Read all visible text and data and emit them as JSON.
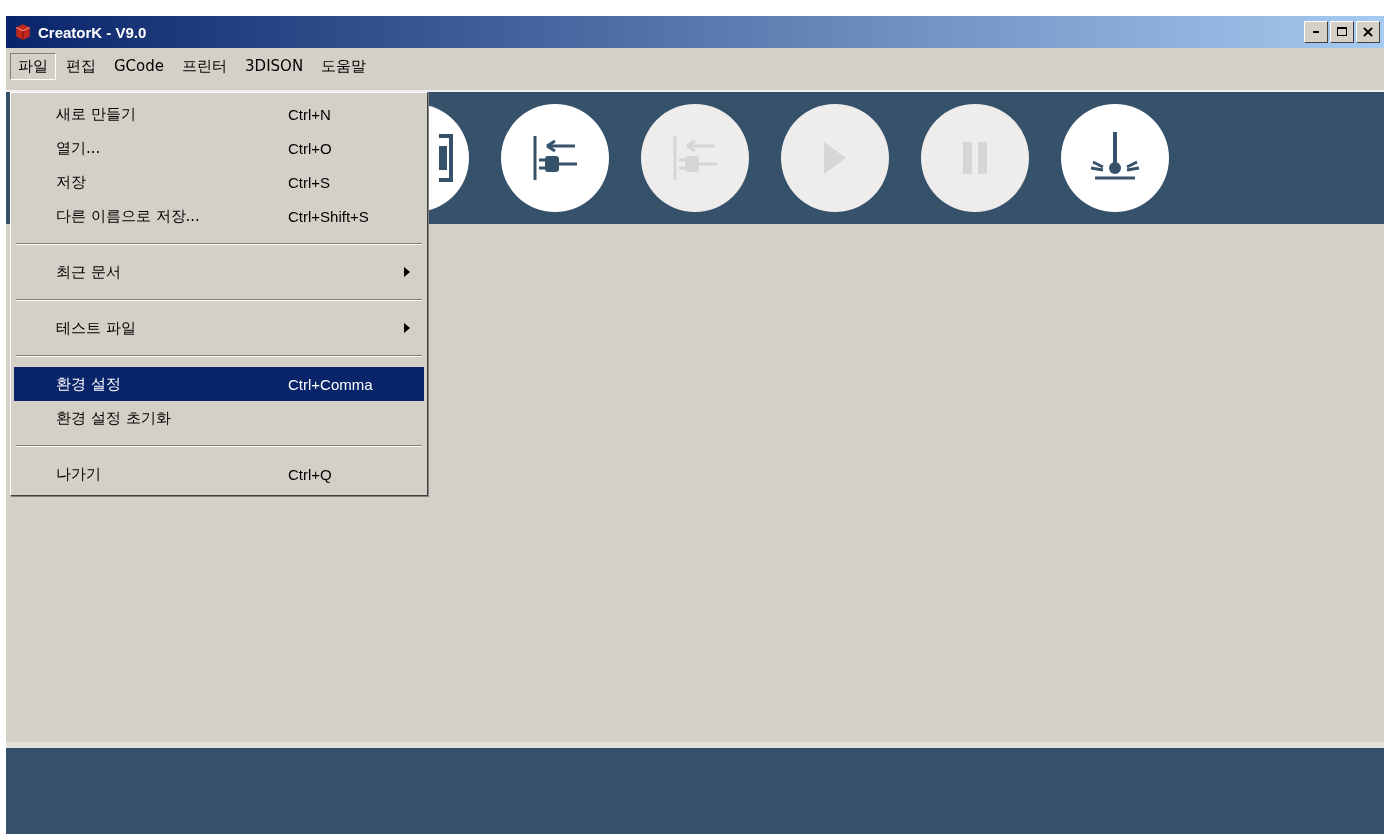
{
  "window": {
    "title": "CreatorK - V9.0"
  },
  "menubar": [
    {
      "label": "파일",
      "selected": true
    },
    {
      "label": "편집",
      "selected": false
    },
    {
      "label": "GCode",
      "selected": false
    },
    {
      "label": "프린터",
      "selected": false
    },
    {
      "label": "3DISON",
      "selected": false
    },
    {
      "label": "도움말",
      "selected": false
    }
  ],
  "file_menu": [
    {
      "kind": "item",
      "label": "새로 만들기",
      "shortcut": "Ctrl+N",
      "selected": false
    },
    {
      "kind": "item",
      "label": "열기...",
      "shortcut": "Ctrl+O",
      "selected": false
    },
    {
      "kind": "item",
      "label": "저장",
      "shortcut": "Ctrl+S",
      "selected": false
    },
    {
      "kind": "item",
      "label": "다른 이름으로 저장...",
      "shortcut": "Ctrl+Shift+S",
      "selected": false
    },
    {
      "kind": "separator"
    },
    {
      "kind": "submenu",
      "label": "최근 문서",
      "selected": false
    },
    {
      "kind": "separator"
    },
    {
      "kind": "submenu",
      "label": "테스트 파일",
      "selected": false
    },
    {
      "kind": "separator"
    },
    {
      "kind": "item",
      "label": "환경 설정",
      "shortcut": "Ctrl+Comma",
      "selected": true
    },
    {
      "kind": "item",
      "label": "환경 설정 초기화",
      "selected": false
    },
    {
      "kind": "separator"
    },
    {
      "kind": "item",
      "label": "나가기",
      "shortcut": "Ctrl+Q",
      "selected": false
    }
  ],
  "toolbar": [
    {
      "kind": "save",
      "disabled": false
    },
    {
      "kind": "connect",
      "disabled": false
    },
    {
      "kind": "disconnect",
      "disabled": true
    },
    {
      "kind": "play",
      "disabled": true
    },
    {
      "kind": "pause",
      "disabled": true
    },
    {
      "kind": "laser",
      "disabled": false
    }
  ]
}
